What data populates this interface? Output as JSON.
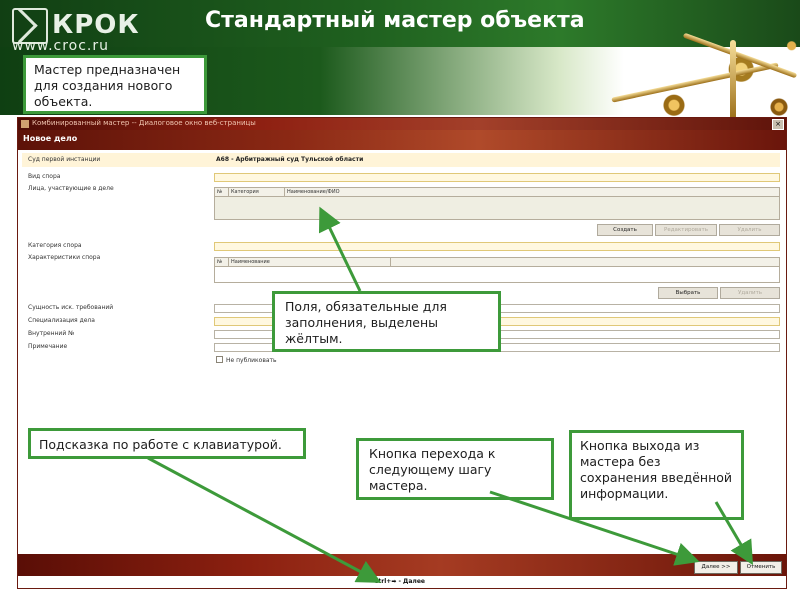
{
  "slide": {
    "logo_text": "КРОК",
    "logo_url": "www.croc.ru",
    "title": "Стандартный мастер объекта"
  },
  "callouts": {
    "intro": "Мастер предназначен для создания нового объекта.",
    "required_fields": "Поля, обязательные для заполнения, выделены жёлтым.",
    "keyboard_hint": "Подсказка по работе с клавиатурой.",
    "next_button": "Кнопка перехода к следующему шагу мастера.",
    "cancel_button": "Кнопка выхода из мастера без сохранения введённой информации."
  },
  "dialog": {
    "window_title": "Комбинированный мастер -- Диалоговое окно веб-страницы",
    "close_glyph": "×",
    "form_title": "Новое дело",
    "fields": {
      "court_label": "Суд первой инстанции",
      "court_value": "А68 - Арбитражный суд Тульской области",
      "dispute_type": "Вид спора",
      "participants": "Лица, участвующие в деле",
      "dispute_category": "Категория спора",
      "dispute_characteristics": "Характеристики спора",
      "claims_essence": "Сущность иск. требований",
      "case_specialization": "Специализация дела",
      "internal_number": "Внутренний №",
      "note": "Примечание",
      "no_publish": "Не публиковать"
    },
    "participants_grid": {
      "columns": [
        "№",
        "Категория",
        "Наименование/ФИО"
      ],
      "buttons": {
        "create": "Создать",
        "edit": "Редактировать",
        "delete": "Удалить"
      }
    },
    "characteristics_grid": {
      "columns": [
        "№",
        "Наименование"
      ],
      "buttons": {
        "choose": "Выбрать",
        "delete": "Удалить"
      }
    },
    "footer": {
      "next": "Далее >>",
      "cancel": "Отменить",
      "hint_key": "Ctrl+",
      "hint_arrow": "➡",
      "hint_action": " - Далее"
    }
  },
  "colors": {
    "callout_border": "#3d9a3a",
    "dialog_dark_red": "#8a2814",
    "required_yellow": "#fff8e0"
  }
}
